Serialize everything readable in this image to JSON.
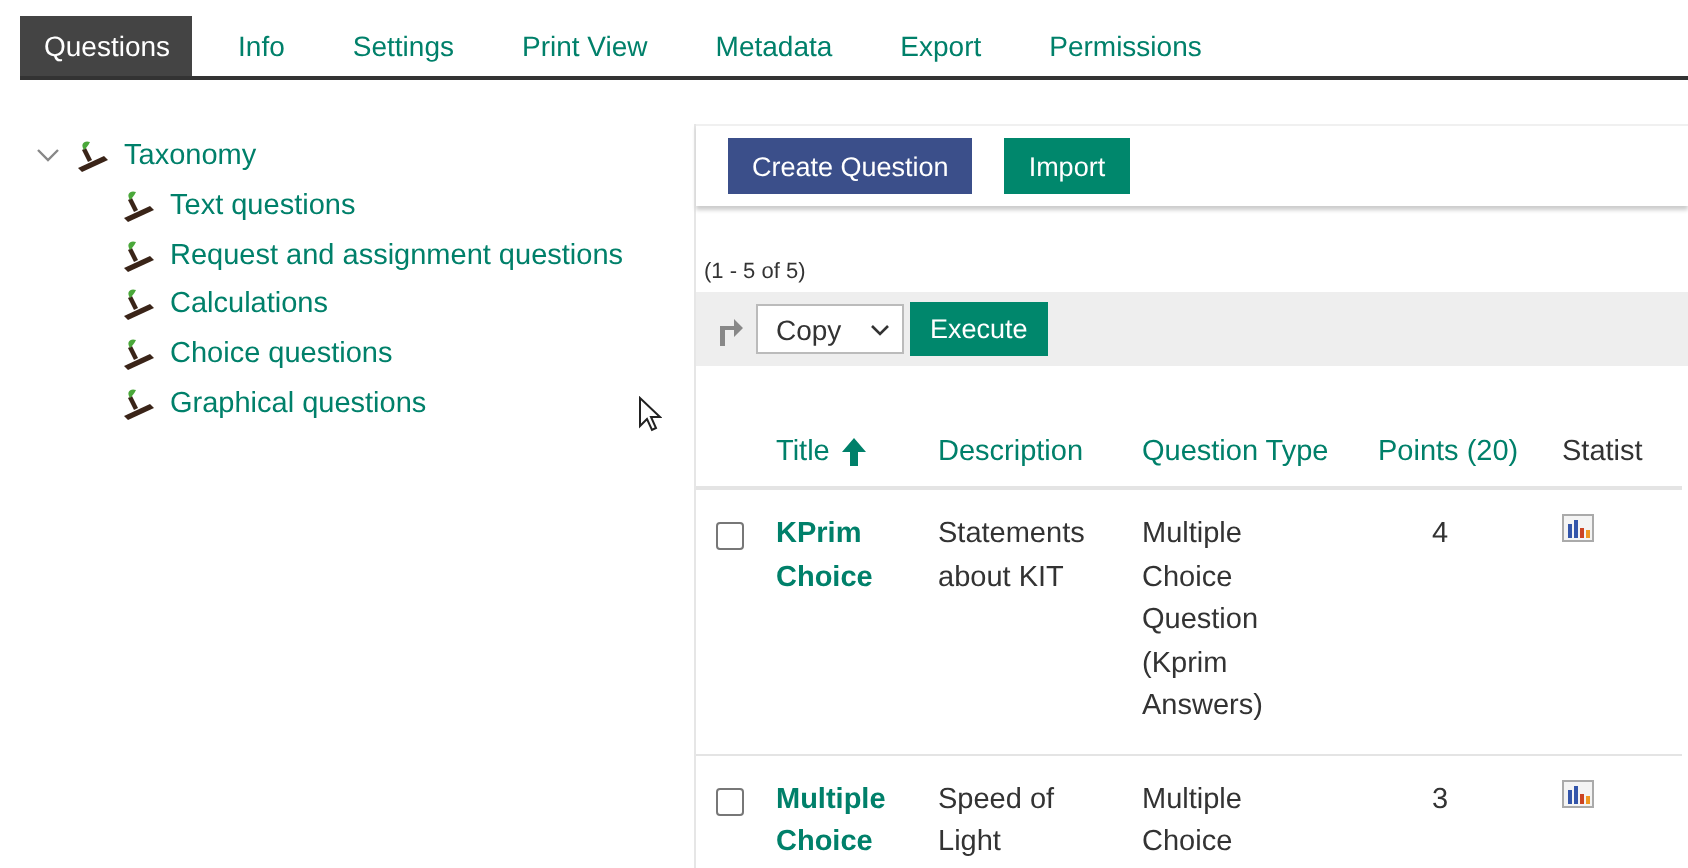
{
  "tabs": [
    {
      "label": "Questions",
      "selected": true
    },
    {
      "label": "Info",
      "selected": false
    },
    {
      "label": "Settings",
      "selected": false
    },
    {
      "label": "Print View",
      "selected": false
    },
    {
      "label": "Metadata",
      "selected": false
    },
    {
      "label": "Export",
      "selected": false
    },
    {
      "label": "Permissions",
      "selected": false
    }
  ],
  "taxonomy": {
    "label": "Taxonomy",
    "expanded": true,
    "children": [
      {
        "label": "Text questions"
      },
      {
        "label": "Request and assignment questions"
      },
      {
        "label": "Calculations"
      },
      {
        "label": "Choice questions"
      },
      {
        "label": "Graphical questions"
      }
    ]
  },
  "toolbar": {
    "buttons": [
      {
        "label": "Create Question",
        "kind": "primary"
      },
      {
        "label": "Import",
        "kind": "secondary"
      }
    ]
  },
  "table": {
    "range": "(1 - 5 of 5)",
    "action": {
      "value": "Copy",
      "button": "Execute"
    },
    "columns": [
      {
        "label": "Title",
        "sortable": true,
        "sorted": true
      },
      {
        "label": "Description",
        "sortable": true,
        "sorted": false
      },
      {
        "label": "Question Type",
        "sortable": true,
        "sorted": false
      },
      {
        "label": "Points (20)",
        "sortable": true,
        "sorted": false
      },
      {
        "label": "Statist",
        "sortable": false
      }
    ],
    "rows": [
      {
        "checked": false,
        "title": "KPrim Choice",
        "description": "Statements about KIT",
        "type": "Multiple Choice Question (Kprim Answers)",
        "points": "4"
      },
      {
        "checked": false,
        "title": "Multiple Choice",
        "description": "Speed of Light",
        "type": "Multiple Choice",
        "points": "3"
      }
    ]
  }
}
